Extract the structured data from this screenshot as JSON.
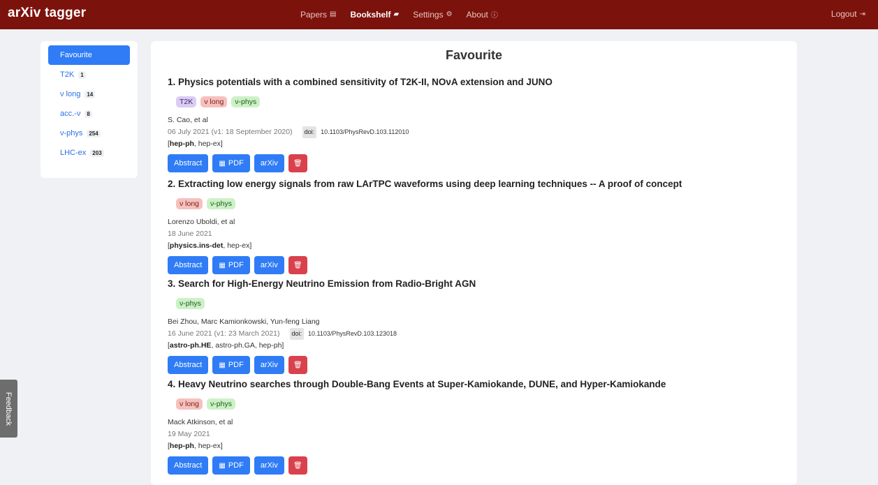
{
  "app": {
    "brand": "arXiv tagger"
  },
  "nav": {
    "items": [
      {
        "label": "Papers",
        "icon": "newspaper-icon",
        "glyph": "▤"
      },
      {
        "label": "Bookshelf",
        "icon": "book-icon",
        "glyph": "▰"
      },
      {
        "label": "Settings",
        "icon": "cogs-icon",
        "glyph": "⚙"
      },
      {
        "label": "About",
        "icon": "info-circle-icon",
        "glyph": "ⓘ"
      }
    ],
    "logout": "Logout",
    "logout_glyph": "⇥"
  },
  "sidebar": {
    "items": [
      {
        "label": "Favourite",
        "count": ""
      },
      {
        "label": "T2K",
        "count": "1"
      },
      {
        "label": "ν long",
        "count": "14"
      },
      {
        "label": "acc.-ν",
        "count": "8"
      },
      {
        "label": "ν-phys",
        "count": "254"
      },
      {
        "label": "LHC-ex",
        "count": "203"
      }
    ]
  },
  "main": {
    "title": "Favourite"
  },
  "buttons": {
    "abstract": "Abstract",
    "pdf": "PDF",
    "arxiv": "arXiv",
    "pdf_glyph": "▦",
    "delete_glyph": "🗑"
  },
  "doi_label": "doi:",
  "papers": [
    {
      "title": "1. Physics potentials with a combined sensitivity of T2K-II, NOνA extension and JUNO",
      "tags": [
        "T2K",
        "ν long",
        "ν-phys"
      ],
      "authors": "S. Cao, et al",
      "date": "06 July 2021 (v1: 18 September 2020)",
      "doi": "10.1103/PhysRevD.103.112010",
      "primary_cat": "hep-ph",
      "other_cats": ", hep-ex]"
    },
    {
      "title": "2. Extracting low energy signals from raw LArTPC waveforms using deep learning techniques -- A proof of concept",
      "tags": [
        "ν long",
        "ν-phys"
      ],
      "authors": "Lorenzo Uboldi, et al",
      "date": "18 June 2021",
      "doi": "",
      "primary_cat": "physics.ins-det",
      "other_cats": ", hep-ex]"
    },
    {
      "title": "3. Search for High-Energy Neutrino Emission from Radio-Bright AGN",
      "tags": [
        "ν-phys"
      ],
      "authors": "Bei Zhou, Marc Kamionkowski, Yun-feng Liang",
      "date": "16 June 2021 (v1: 23 March 2021)",
      "doi": "10.1103/PhysRevD.103.123018",
      "primary_cat": "astro-ph.HE",
      "other_cats": ", astro-ph.GA, hep-ph]"
    },
    {
      "title": "4. Heavy Neutrino searches through Double-Bang Events at Super-Kamiokande, DUNE, and Hyper-Kamiokande",
      "tags": [
        "ν long",
        "ν-phys"
      ],
      "authors": "Mack Atkinson, et al",
      "date": "19 May 2021",
      "doi": "",
      "primary_cat": "hep-ph",
      "other_cats": ", hep-ex]"
    }
  ],
  "feedback": "Feedback",
  "colors": {
    "navbar": "#7c120c",
    "primary": "#2f7cf6",
    "danger": "#d9414c",
    "tag_t2k": "#dcccf3",
    "tag_nu_long": "#f6c1bd",
    "tag_nu_phys": "#cdf1c7"
  }
}
